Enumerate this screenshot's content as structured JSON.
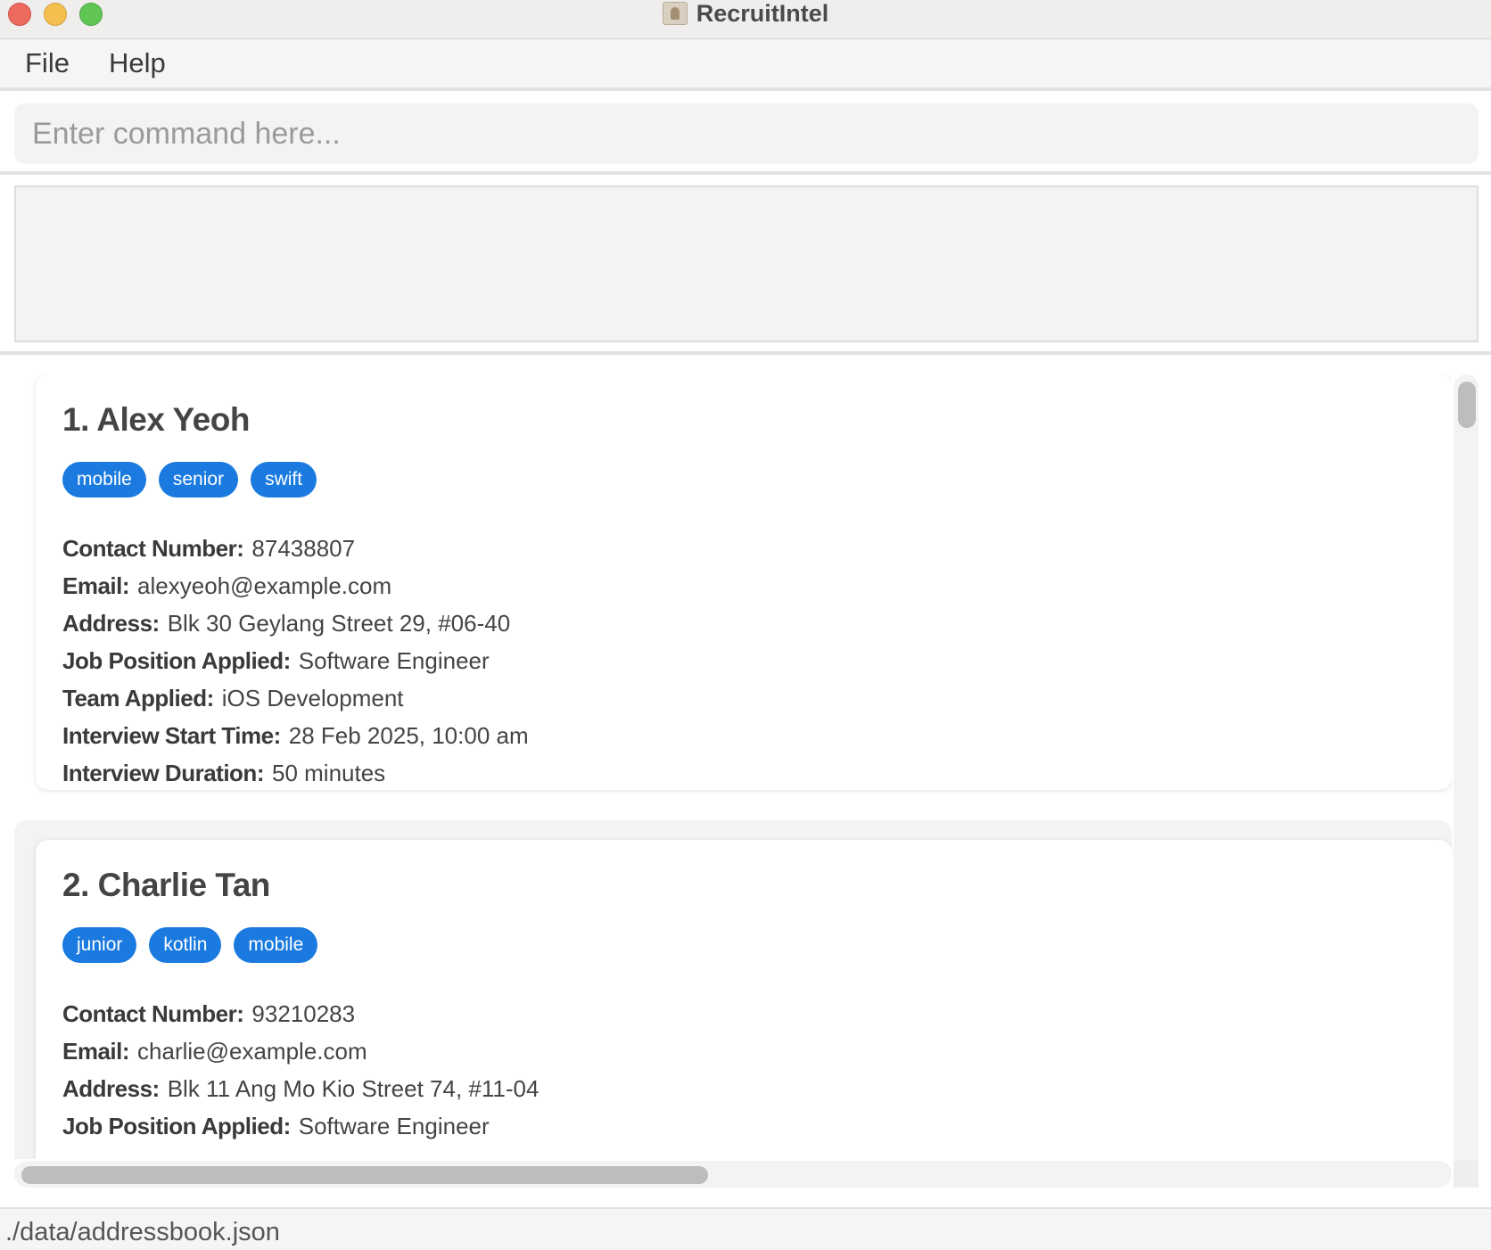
{
  "window": {
    "title": "RecruitIntel"
  },
  "menu": {
    "file": "File",
    "help": "Help"
  },
  "command": {
    "placeholder": "Enter command here..."
  },
  "result": {
    "text": ""
  },
  "persons": [
    {
      "name": "1. Alex Yeoh",
      "tags": [
        "mobile",
        "senior",
        "swift"
      ],
      "fields": [
        {
          "label": "Contact Number:",
          "value": "87438807"
        },
        {
          "label": "Email:",
          "value": "alexyeoh@example.com"
        },
        {
          "label": "Address:",
          "value": "Blk 30 Geylang Street 29, #06-40"
        },
        {
          "label": "Job Position Applied:",
          "value": "Software Engineer"
        },
        {
          "label": "Team Applied:",
          "value": "iOS Development"
        },
        {
          "label": "Interview Start Time:",
          "value": "28 Feb 2025, 10:00 am"
        },
        {
          "label": "Interview Duration:",
          "value": "50 minutes"
        }
      ]
    },
    {
      "name": "2. Charlie Tan",
      "tags": [
        "junior",
        "kotlin",
        "mobile"
      ],
      "fields": [
        {
          "label": "Contact Number:",
          "value": "93210283"
        },
        {
          "label": "Email:",
          "value": "charlie@example.com"
        },
        {
          "label": "Address:",
          "value": "Blk 11 Ang Mo Kio Street 74, #11-04"
        },
        {
          "label": "Job Position Applied:",
          "value": "Software Engineer"
        }
      ]
    }
  ],
  "status": {
    "path": "./data/addressbook.json"
  },
  "colors": {
    "tag": "#1a7ae0",
    "close": "#ed6a5e",
    "minimize": "#f4bf4f",
    "maximize": "#61c554"
  }
}
